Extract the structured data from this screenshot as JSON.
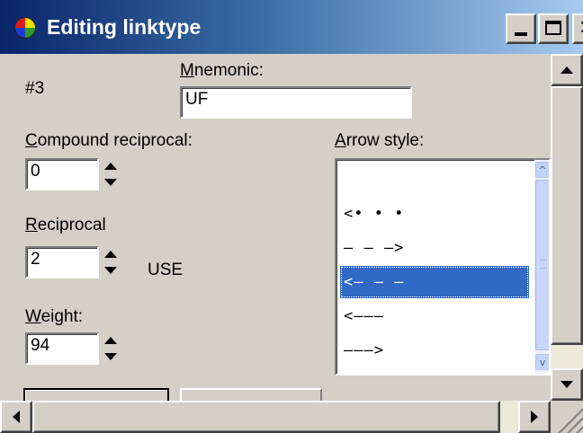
{
  "window": {
    "title": "Editing linktype",
    "accent": "#0a246a",
    "title_icon": "colored-ball-icon"
  },
  "titlebar_buttons": {
    "minimize_icon": "minimize-icon",
    "maximize_icon": "maximize-icon",
    "close_icon": "close-icon"
  },
  "record": {
    "id": "#3"
  },
  "mnemonic": {
    "label_accel": "M",
    "label_rest": "nemonic:",
    "value": "UF"
  },
  "compound_reciprocal": {
    "label_accel": "C",
    "label_rest": "ompound reciprocal:",
    "value": "0"
  },
  "reciprocal": {
    "label_accel": "R",
    "label_rest": "eciprocal",
    "value": "2",
    "mnemonic_display": "USE"
  },
  "weight": {
    "label_accel": "W",
    "label_rest": "eight:",
    "value": "94"
  },
  "arrow_style": {
    "label_accel": "A",
    "label_rest": "rrow style:",
    "items": [
      {
        "text": "<•  •  •"
      },
      {
        "text": "— — —>"
      },
      {
        "text": "<— — —"
      },
      {
        "text": "<———"
      },
      {
        "text": "———>"
      },
      {
        "text": "<— —>"
      }
    ],
    "selected_index": 2,
    "selection_color": "#3169c6"
  }
}
